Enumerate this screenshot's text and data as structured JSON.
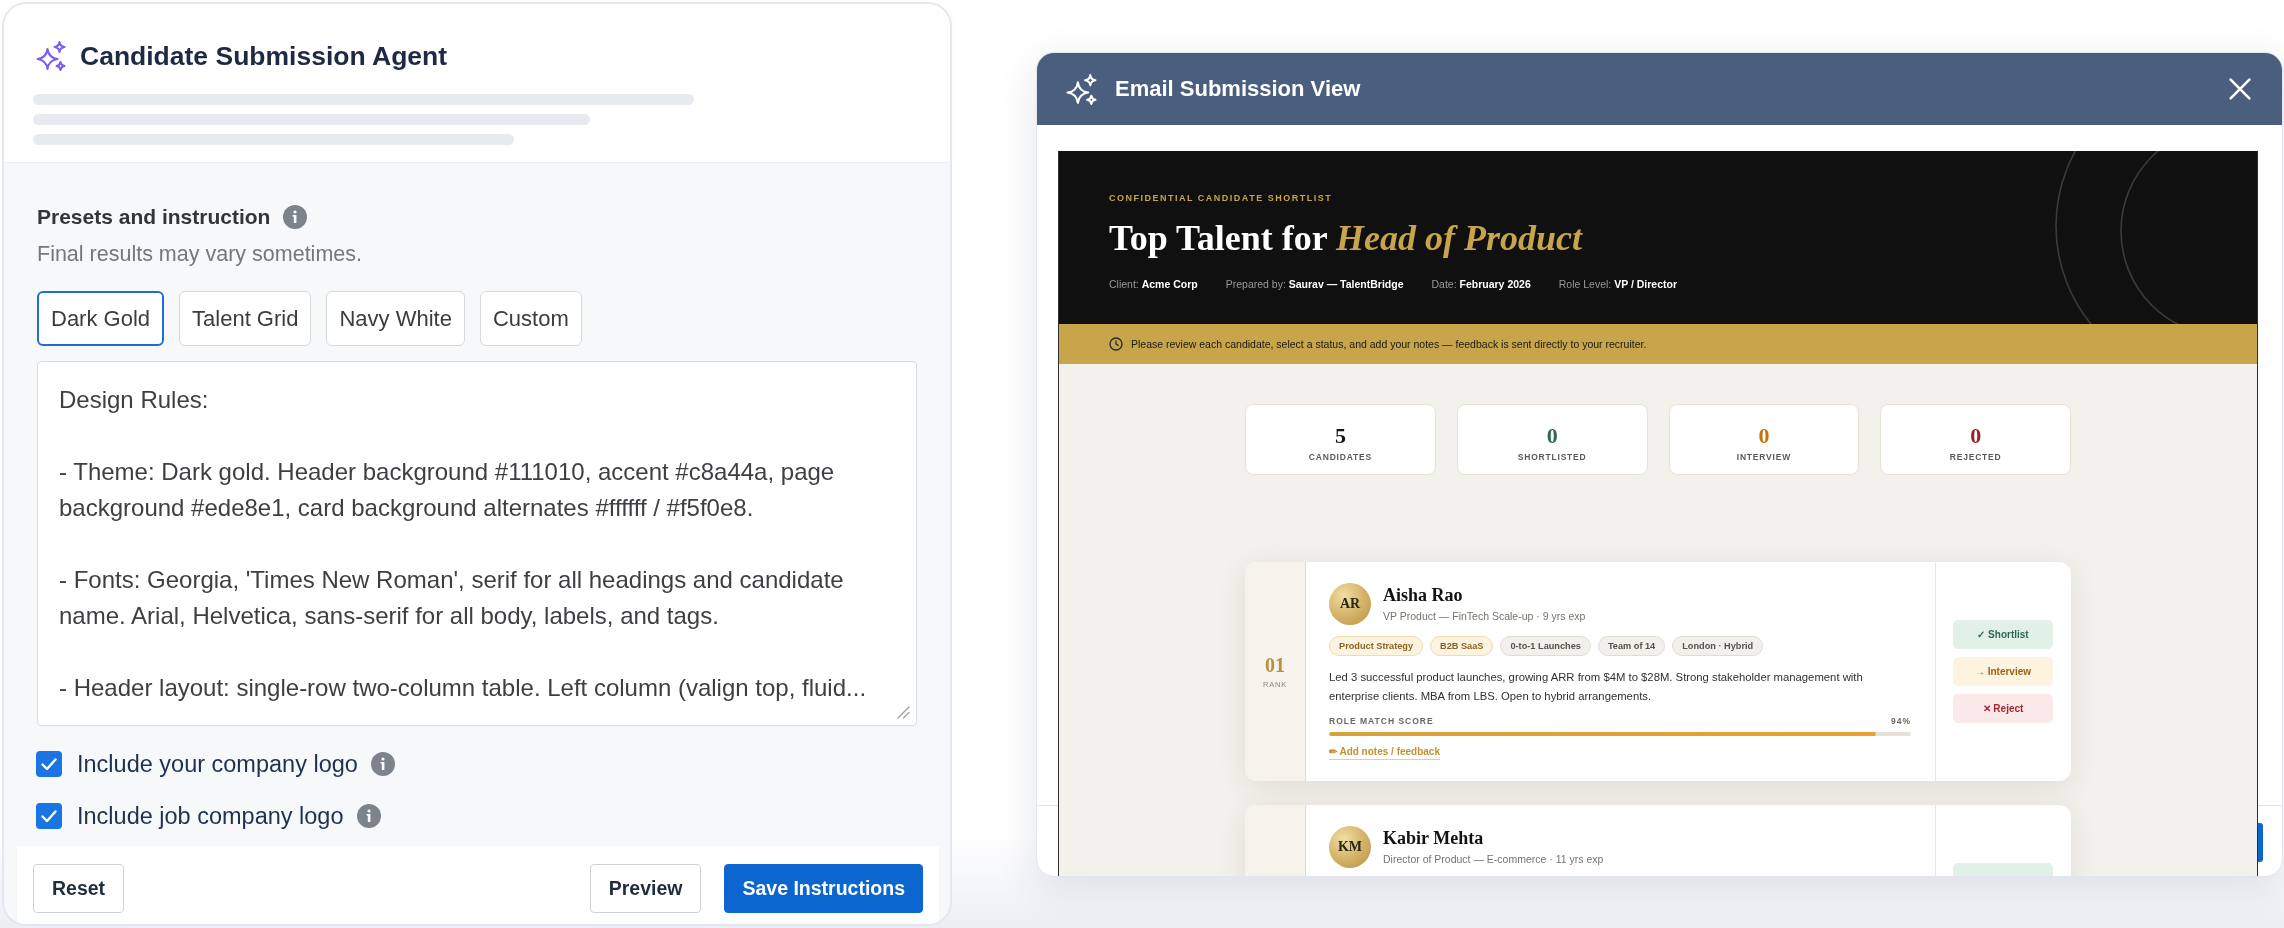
{
  "agent_panel": {
    "title": "Candidate Submission Agent",
    "section": {
      "heading": "Presets and instruction",
      "hint": "Final results may vary sometimes."
    },
    "presets": [
      {
        "label": "Dark Gold",
        "selected": true
      },
      {
        "label": "Talent Grid",
        "selected": false
      },
      {
        "label": "Navy White",
        "selected": false
      },
      {
        "label": "Custom",
        "selected": false
      }
    ],
    "instructions": {
      "value": "Design Rules:\n\n- Theme: Dark gold. Header background #111010, accent #c8a44a, page background #ede8e1, card background alternates #ffffff / #f5f0e8.\n\n- Fonts: Georgia, 'Times New Roman', serif for all headings and candidate name. Arial, Helvetica, sans-serif for all body, labels, and tags.\n\n- Header layout: single-row two-column table. Left column (valign top, fluid..."
    },
    "options": [
      {
        "label": "Include your company logo",
        "checked": true
      },
      {
        "label": "Include job company logo",
        "checked": true
      }
    ],
    "footer": {
      "start": [
        {
          "label": "Reset",
          "kind": "reset"
        }
      ],
      "end": [
        {
          "label": "Preview",
          "kind": "preview"
        },
        {
          "label": "Save Instructions",
          "kind": "save"
        }
      ]
    }
  },
  "email_view": {
    "title": "Email Submission View",
    "email": {
      "eyebrow": "CONFIDENTIAL CANDIDATE SHORTLIST",
      "headline": "Top Talent for *Head of Product*",
      "meta": [
        "Client: **Acme Corp**",
        "Prepared by: **Saurav — TalentBridge**",
        "Date: **February 2026**",
        "Role Level: **VP / Director**"
      ],
      "notice": "Please review each candidate, select a status, and add your notes — feedback is sent directly to your recruiter.",
      "stats": [
        {
          "value": "5",
          "label": "CANDIDATES",
          "color": "#141414"
        },
        {
          "value": "0",
          "label": "SHORTLISTED",
          "color": "#2d6a4f"
        },
        {
          "value": "0",
          "label": "INTERVIEW",
          "color": "#c8700a"
        },
        {
          "value": "0",
          "label": "REJECTED",
          "color": "#9b2226"
        }
      ],
      "candidates": [
        {
          "rank": "01",
          "rank_label": "RANK",
          "initials": "AR",
          "name": "Aisha Rao",
          "subtitle": "VP Product — FinTech Scale-up · 9 yrs exp",
          "tags": [
            {
              "label": "Product Strategy",
              "kind": "highlight"
            },
            {
              "label": "B2B SaaS",
              "kind": "highlight"
            },
            {
              "label": "0-to-1 Launches",
              "kind": "neutral"
            },
            {
              "label": "Team of 14",
              "kind": "neutral"
            },
            {
              "label": "London · Hybrid",
              "kind": "neutral"
            }
          ],
          "summary": "Led 3 successful product launches, growing ARR from $4M to $28M. Strong stakeholder management with enterprise clients. MBA from LBS. Open to hybrid arrangements.",
          "score": {
            "label": "ROLE MATCH SCORE",
            "reading": "94%",
            "level": 0.94
          },
          "notes_link": "✏ Add notes / feedback",
          "actions": [
            {
              "label": "✓ Shortlist",
              "kind": "shortlist"
            },
            {
              "label": "→ Interview",
              "kind": "interview"
            },
            {
              "label": "✕ Reject",
              "kind": "reject"
            }
          ]
        },
        {
          "initials": "KM",
          "name": "Kabir Mehta",
          "subtitle": "Director of Product — E-commerce · 11 yrs exp",
          "actions": [
            {
              "kind": "shortlist"
            }
          ]
        }
      ]
    }
  }
}
